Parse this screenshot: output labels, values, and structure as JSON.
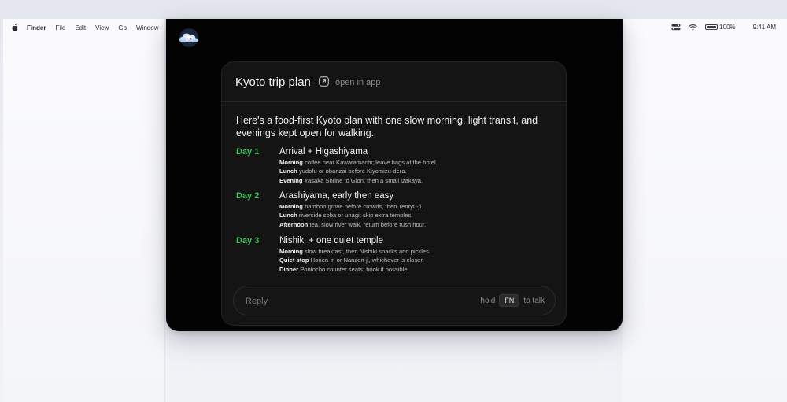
{
  "menubar": {
    "app_name": "Finder",
    "menus": [
      "File",
      "Edit",
      "View",
      "Go",
      "Window"
    ],
    "battery": "100%",
    "time": "9:41 AM"
  },
  "card": {
    "title": "Kyoto trip plan",
    "open_in_app": "open in app",
    "intro": "Here's a food-first Kyoto plan with one slow morning, light transit, and evenings kept open for walking.",
    "days": [
      {
        "label": "Day 1",
        "title": "Arrival + Higashiyama",
        "items": [
          {
            "label": "Morning",
            "text": "coffee near Kawaramachi; leave bags at the hotel."
          },
          {
            "label": "Lunch",
            "text": "yudofu or obanzai before Kiyomizu-dera."
          },
          {
            "label": "Evening",
            "text": "Yasaka Shrine to Gion, then a small izakaya."
          }
        ]
      },
      {
        "label": "Day 2",
        "title": "Arashiyama, early then easy",
        "items": [
          {
            "label": "Morning",
            "text": "bamboo grove before crowds, then Tenryu-ji."
          },
          {
            "label": "Lunch",
            "text": "riverside soba or unagi; skip extra temples."
          },
          {
            "label": "Afternoon",
            "text": "tea, slow river walk, return before rush hour."
          }
        ]
      },
      {
        "label": "Day 3",
        "title": "Nishiki + one quiet temple",
        "items": [
          {
            "label": "Morning",
            "text": "slow breakfast, then Nishiki snacks and pickles."
          },
          {
            "label": "Quiet stop",
            "text": "Honen-in or Nanzen-ji, whichever is closer."
          },
          {
            "label": "Dinner",
            "text": "Pontocho counter seats; book if possible."
          }
        ]
      }
    ],
    "reply": {
      "placeholder": "Reply",
      "hint_before": "hold",
      "key": "FN",
      "hint_after": "to talk"
    }
  },
  "colors": {
    "accent_green": "#3fbf5a",
    "window_bg": "#030303",
    "card_bg": "#141414"
  },
  "icons": [
    "apple-icon",
    "cloud-assistant-icon",
    "external-link-icon",
    "control-center-icon",
    "wifi-icon",
    "battery-icon"
  ]
}
